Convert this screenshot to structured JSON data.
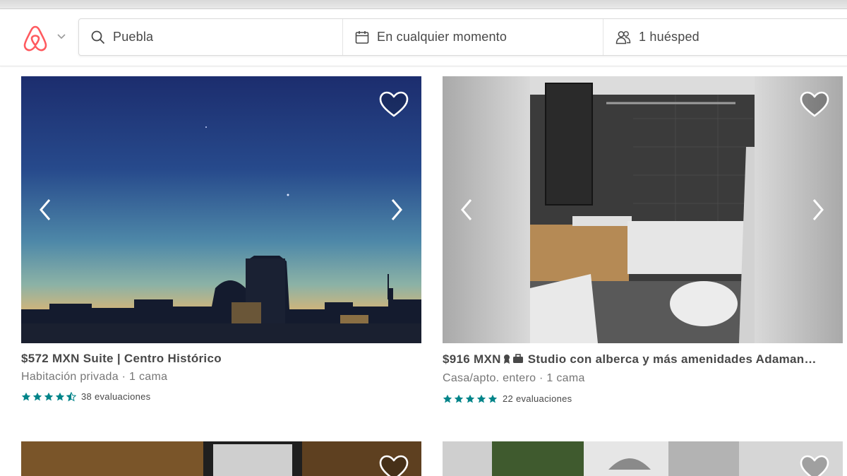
{
  "search": {
    "location": "Puebla",
    "dates": "En cualquier momento",
    "guests": "1 huésped"
  },
  "colors": {
    "brand": "#FF5A5F",
    "star": "#008489"
  },
  "listings": [
    {
      "price": "$572 MXN",
      "name": "Suite | Centro Histórico",
      "type": "Habitación privada · 1 cama",
      "reviews": "38 evaluaciones",
      "rating": 4.5
    },
    {
      "price": "$916 MXN",
      "name": "Studio con alberca y más amenidades Adaman…",
      "type": "Casa/apto. entero · 1 cama",
      "reviews": "22 evaluaciones",
      "rating": 5
    }
  ]
}
